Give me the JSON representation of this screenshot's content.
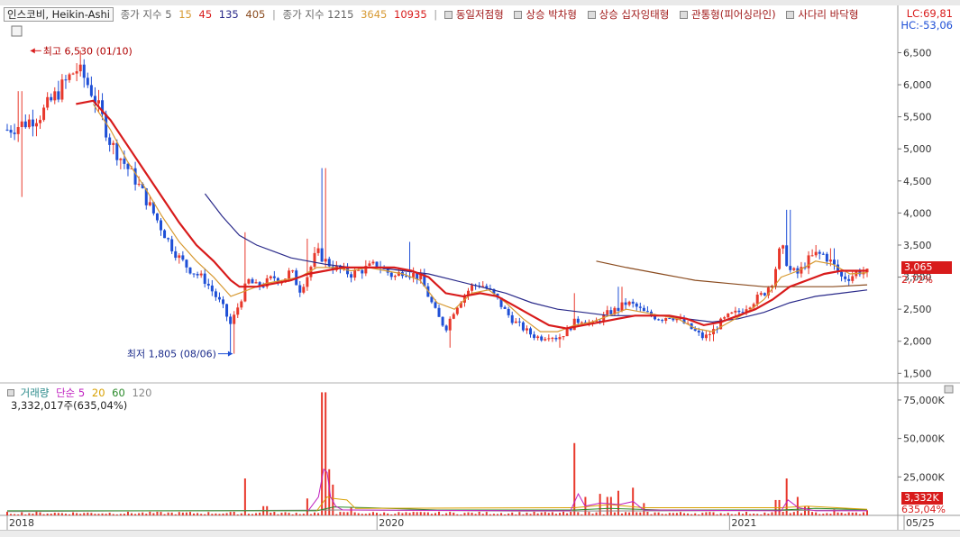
{
  "header": {
    "title": "인스코비, Heikin-Ashi",
    "ma_short": {
      "label": "종가 지수 5",
      "values": [
        "15",
        "45",
        "135",
        "405"
      ]
    },
    "ma_long": {
      "label": "종가 지수 1215",
      "values": [
        "3645",
        "10935"
      ]
    },
    "patterns": [
      "동일저점형",
      "상승 박차형",
      "상승 십자잉태형",
      "관통형(피어싱라인)",
      "사다리 바닥형"
    ],
    "lc": "LC:69,81",
    "hc": "HC:-53,06"
  },
  "price_axis": {
    "ticks": [
      "6,500",
      "6,000",
      "5,500",
      "5,000",
      "4,500",
      "4,000",
      "3,500",
      "3,000",
      "2,500",
      "2,000",
      "1,500"
    ],
    "tick_values": [
      6500,
      6000,
      5500,
      5000,
      4500,
      4000,
      3500,
      3000,
      2500,
      2000,
      1500
    ],
    "range": [
      1350,
      6900
    ]
  },
  "volume_axis": {
    "ticks": [
      "75,000K",
      "50,000K",
      "25,000K"
    ],
    "tick_values": [
      75000,
      50000,
      25000
    ],
    "range": [
      0,
      82000
    ]
  },
  "x_axis": {
    "ticks": [
      "2018",
      "2020",
      "2021",
      "05/25"
    ],
    "tick_pos": [
      0.0,
      0.43,
      0.84,
      1.0
    ]
  },
  "annotations": {
    "high": {
      "text": "최고 6,530 (01/10)",
      "value": 6530,
      "x": 0.027
    },
    "low": {
      "text": "최저 1,805 (08/06)",
      "value": 1805,
      "x": 0.262
    }
  },
  "current": {
    "price": "3,065",
    "price_value": 3065,
    "change": "2,72%",
    "volume": "3,332K",
    "volume_value": 3332,
    "volume_change": "635,04%"
  },
  "volume_legend": {
    "title": "거래량",
    "ma_label": "단순",
    "periods": [
      "5",
      "20",
      "60",
      "120"
    ]
  },
  "volume_info": "3,332,017주(635,04%)",
  "colors": {
    "up": "#e8382b",
    "down": "#1e4fd6",
    "ma_red": "#d81b1b",
    "ma_orange": "#d79a33",
    "ma_navy": "#2a2a8a",
    "ma_brown": "#8a4b1e",
    "tag": "#d81b1b",
    "vol_ma5": "#c020c0",
    "vol_ma20": "#d8a000",
    "vol_ma60": "#2a8a2a",
    "vol_ma120": "#888888"
  },
  "chart_data": {
    "type": "candlestick",
    "title": "인스코비, Heikin-Ashi",
    "x": {
      "start": 0.0,
      "end": 1.0,
      "labels": [
        "2018",
        "2020",
        "2021",
        "05/25"
      ]
    },
    "ylim": [
      1350,
      6900
    ],
    "price_path": [
      [
        0.0,
        5300
      ],
      [
        0.02,
        5400
      ],
      [
        0.04,
        5550
      ],
      [
        0.06,
        5900
      ],
      [
        0.08,
        6250
      ],
      [
        0.09,
        6100
      ],
      [
        0.1,
        5850
      ],
      [
        0.11,
        5500
      ],
      [
        0.12,
        5100
      ],
      [
        0.13,
        4900
      ],
      [
        0.14,
        4700
      ],
      [
        0.15,
        4500
      ],
      [
        0.16,
        4250
      ],
      [
        0.17,
        4000
      ],
      [
        0.18,
        3750
      ],
      [
        0.19,
        3500
      ],
      [
        0.2,
        3300
      ],
      [
        0.21,
        3150
      ],
      [
        0.22,
        3050
      ],
      [
        0.23,
        2950
      ],
      [
        0.24,
        2750
      ],
      [
        0.25,
        2550
      ],
      [
        0.26,
        2250
      ],
      [
        0.27,
        2600
      ],
      [
        0.28,
        2950
      ],
      [
        0.29,
        2850
      ],
      [
        0.3,
        2900
      ],
      [
        0.31,
        3000
      ],
      [
        0.32,
        2950
      ],
      [
        0.33,
        3100
      ],
      [
        0.34,
        2800
      ],
      [
        0.35,
        3050
      ],
      [
        0.36,
        3400
      ],
      [
        0.37,
        3250
      ],
      [
        0.38,
        3150
      ],
      [
        0.39,
        3100
      ],
      [
        0.4,
        3050
      ],
      [
        0.41,
        3100
      ],
      [
        0.42,
        3150
      ],
      [
        0.43,
        3200
      ],
      [
        0.44,
        3100
      ],
      [
        0.45,
        3000
      ],
      [
        0.46,
        3100
      ],
      [
        0.47,
        3050
      ],
      [
        0.48,
        3000
      ],
      [
        0.49,
        2700
      ],
      [
        0.5,
        2400
      ],
      [
        0.51,
        2200
      ],
      [
        0.52,
        2500
      ],
      [
        0.53,
        2700
      ],
      [
        0.54,
        2850
      ],
      [
        0.55,
        2900
      ],
      [
        0.56,
        2800
      ],
      [
        0.57,
        2650
      ],
      [
        0.58,
        2450
      ],
      [
        0.59,
        2300
      ],
      [
        0.6,
        2200
      ],
      [
        0.61,
        2100
      ],
      [
        0.62,
        2050
      ],
      [
        0.63,
        2100
      ],
      [
        0.64,
        2050
      ],
      [
        0.65,
        2150
      ],
      [
        0.66,
        2300
      ],
      [
        0.67,
        2350
      ],
      [
        0.68,
        2250
      ],
      [
        0.69,
        2350
      ],
      [
        0.7,
        2450
      ],
      [
        0.71,
        2500
      ],
      [
        0.72,
        2600
      ],
      [
        0.73,
        2550
      ],
      [
        0.74,
        2450
      ],
      [
        0.75,
        2400
      ],
      [
        0.76,
        2350
      ],
      [
        0.77,
        2400
      ],
      [
        0.78,
        2350
      ],
      [
        0.79,
        2250
      ],
      [
        0.8,
        2150
      ],
      [
        0.81,
        2050
      ],
      [
        0.82,
        2150
      ],
      [
        0.83,
        2300
      ],
      [
        0.84,
        2400
      ],
      [
        0.85,
        2450
      ],
      [
        0.86,
        2550
      ],
      [
        0.87,
        2650
      ],
      [
        0.88,
        2750
      ],
      [
        0.89,
        2950
      ],
      [
        0.9,
        3500
      ],
      [
        0.91,
        3100
      ],
      [
        0.92,
        3050
      ],
      [
        0.93,
        3250
      ],
      [
        0.94,
        3350
      ],
      [
        0.95,
        3350
      ],
      [
        0.96,
        3200
      ],
      [
        0.97,
        3000
      ],
      [
        0.98,
        3000
      ],
      [
        0.99,
        3100
      ],
      [
        1.0,
        3065
      ]
    ],
    "spikes": [
      [
        0.007,
        4100
      ],
      [
        0.015,
        5900
      ],
      [
        0.072,
        5600
      ],
      [
        0.086,
        6530
      ],
      [
        0.276,
        3700
      ],
      [
        0.348,
        3600
      ],
      [
        0.368,
        4700
      ],
      [
        0.468,
        3550
      ],
      [
        0.659,
        2750
      ],
      [
        0.712,
        2850
      ],
      [
        0.908,
        4050
      ],
      [
        0.94,
        3500
      ],
      [
        0.96,
        3450
      ]
    ],
    "dips": [
      [
        0.016,
        4250
      ],
      [
        0.262,
        1805
      ],
      [
        0.515,
        1900
      ],
      [
        0.642,
        1900
      ],
      [
        0.82,
        2000
      ]
    ],
    "ma_red": [
      [
        0.08,
        5700
      ],
      [
        0.1,
        5750
      ],
      [
        0.12,
        5450
      ],
      [
        0.14,
        5050
      ],
      [
        0.16,
        4650
      ],
      [
        0.18,
        4250
      ],
      [
        0.2,
        3850
      ],
      [
        0.22,
        3500
      ],
      [
        0.24,
        3250
      ],
      [
        0.26,
        2950
      ],
      [
        0.27,
        2850
      ],
      [
        0.29,
        2850
      ],
      [
        0.31,
        2900
      ],
      [
        0.33,
        2950
      ],
      [
        0.35,
        3050
      ],
      [
        0.37,
        3100
      ],
      [
        0.39,
        3150
      ],
      [
        0.41,
        3150
      ],
      [
        0.43,
        3150
      ],
      [
        0.45,
        3150
      ],
      [
        0.47,
        3100
      ],
      [
        0.49,
        3000
      ],
      [
        0.51,
        2750
      ],
      [
        0.53,
        2700
      ],
      [
        0.55,
        2750
      ],
      [
        0.57,
        2700
      ],
      [
        0.59,
        2550
      ],
      [
        0.61,
        2400
      ],
      [
        0.63,
        2250
      ],
      [
        0.65,
        2200
      ],
      [
        0.67,
        2250
      ],
      [
        0.69,
        2300
      ],
      [
        0.71,
        2350
      ],
      [
        0.73,
        2400
      ],
      [
        0.75,
        2400
      ],
      [
        0.77,
        2400
      ],
      [
        0.79,
        2350
      ],
      [
        0.81,
        2250
      ],
      [
        0.83,
        2300
      ],
      [
        0.85,
        2400
      ],
      [
        0.87,
        2500
      ],
      [
        0.89,
        2650
      ],
      [
        0.91,
        2850
      ],
      [
        0.93,
        2950
      ],
      [
        0.95,
        3050
      ],
      [
        0.97,
        3100
      ],
      [
        1.0,
        3100
      ]
    ],
    "ma_orange": [
      [
        0.1,
        5700
      ],
      [
        0.12,
        5300
      ],
      [
        0.14,
        4800
      ],
      [
        0.16,
        4400
      ],
      [
        0.18,
        3950
      ],
      [
        0.2,
        3550
      ],
      [
        0.22,
        3250
      ],
      [
        0.24,
        3000
      ],
      [
        0.26,
        2700
      ],
      [
        0.28,
        2800
      ],
      [
        0.3,
        2900
      ],
      [
        0.32,
        2950
      ],
      [
        0.34,
        3000
      ],
      [
        0.36,
        3150
      ],
      [
        0.38,
        3150
      ],
      [
        0.4,
        3100
      ],
      [
        0.42,
        3150
      ],
      [
        0.44,
        3100
      ],
      [
        0.46,
        3050
      ],
      [
        0.48,
        2950
      ],
      [
        0.5,
        2600
      ],
      [
        0.52,
        2500
      ],
      [
        0.54,
        2750
      ],
      [
        0.56,
        2800
      ],
      [
        0.58,
        2600
      ],
      [
        0.6,
        2350
      ],
      [
        0.62,
        2150
      ],
      [
        0.64,
        2150
      ],
      [
        0.66,
        2250
      ],
      [
        0.68,
        2300
      ],
      [
        0.7,
        2400
      ],
      [
        0.72,
        2500
      ],
      [
        0.74,
        2450
      ],
      [
        0.76,
        2400
      ],
      [
        0.78,
        2350
      ],
      [
        0.8,
        2200
      ],
      [
        0.82,
        2150
      ],
      [
        0.84,
        2300
      ],
      [
        0.86,
        2450
      ],
      [
        0.88,
        2650
      ],
      [
        0.9,
        3000
      ],
      [
        0.92,
        3100
      ],
      [
        0.94,
        3250
      ],
      [
        0.96,
        3200
      ],
      [
        0.98,
        3050
      ],
      [
        1.0,
        3070
      ]
    ],
    "ma_navy": [
      [
        0.23,
        4300
      ],
      [
        0.25,
        3950
      ],
      [
        0.27,
        3650
      ],
      [
        0.29,
        3500
      ],
      [
        0.31,
        3400
      ],
      [
        0.33,
        3300
      ],
      [
        0.35,
        3250
      ],
      [
        0.37,
        3200
      ],
      [
        0.4,
        3150
      ],
      [
        0.43,
        3150
      ],
      [
        0.46,
        3100
      ],
      [
        0.49,
        3050
      ],
      [
        0.52,
        2950
      ],
      [
        0.55,
        2850
      ],
      [
        0.58,
        2750
      ],
      [
        0.61,
        2600
      ],
      [
        0.64,
        2500
      ],
      [
        0.67,
        2450
      ],
      [
        0.7,
        2400
      ],
      [
        0.73,
        2400
      ],
      [
        0.76,
        2400
      ],
      [
        0.79,
        2350
      ],
      [
        0.82,
        2300
      ],
      [
        0.85,
        2350
      ],
      [
        0.88,
        2450
      ],
      [
        0.91,
        2600
      ],
      [
        0.94,
        2700
      ],
      [
        0.97,
        2750
      ],
      [
        1.0,
        2800
      ]
    ],
    "ma_brown": [
      [
        0.685,
        3250
      ],
      [
        0.72,
        3150
      ],
      [
        0.76,
        3050
      ],
      [
        0.8,
        2950
      ],
      [
        0.84,
        2900
      ],
      [
        0.88,
        2850
      ],
      [
        0.92,
        2850
      ],
      [
        0.96,
        2850
      ],
      [
        1.0,
        2880
      ]
    ],
    "volume": {
      "ylim": [
        0,
        82000
      ],
      "baseline": 1500,
      "spikes": [
        [
          0.276,
          24000
        ],
        [
          0.3,
          6000
        ],
        [
          0.348,
          11000
        ],
        [
          0.368,
          80000
        ],
        [
          0.372,
          30000
        ],
        [
          0.378,
          20000
        ],
        [
          0.4,
          5000
        ],
        [
          0.66,
          47000
        ],
        [
          0.672,
          12000
        ],
        [
          0.69,
          14000
        ],
        [
          0.7,
          12000
        ],
        [
          0.712,
          16000
        ],
        [
          0.728,
          18000
        ],
        [
          0.74,
          8000
        ],
        [
          0.896,
          10000
        ],
        [
          0.908,
          24000
        ],
        [
          0.92,
          12000
        ],
        [
          0.93,
          6000
        ],
        [
          0.96,
          4000
        ],
        [
          1.0,
          3332
        ]
      ],
      "ma5": [
        [
          0.35,
          3000
        ],
        [
          0.362,
          12000
        ],
        [
          0.368,
          30000
        ],
        [
          0.372,
          28000
        ],
        [
          0.376,
          12000
        ],
        [
          0.382,
          6000
        ],
        [
          0.39,
          3500
        ],
        [
          0.655,
          3000
        ],
        [
          0.664,
          14000
        ],
        [
          0.672,
          6000
        ],
        [
          0.69,
          8000
        ],
        [
          0.712,
          7000
        ],
        [
          0.728,
          9000
        ],
        [
          0.74,
          3500
        ],
        [
          0.9,
          3000
        ],
        [
          0.908,
          10000
        ],
        [
          0.92,
          5000
        ],
        [
          0.94,
          3000
        ],
        [
          1.0,
          3000
        ]
      ],
      "ma20": [
        [
          0.36,
          3000
        ],
        [
          0.372,
          12000
        ],
        [
          0.38,
          11000
        ],
        [
          0.395,
          10000
        ],
        [
          0.405,
          4500
        ],
        [
          0.66,
          5000
        ],
        [
          0.7,
          7000
        ],
        [
          0.74,
          5000
        ],
        [
          0.9,
          5000
        ],
        [
          0.93,
          6000
        ],
        [
          1.0,
          4000
        ]
      ],
      "ma60": [
        [
          0.0,
          3000
        ],
        [
          0.36,
          3000
        ],
        [
          0.38,
          5500
        ],
        [
          0.42,
          5000
        ],
        [
          0.5,
          3500
        ],
        [
          0.66,
          3500
        ],
        [
          0.7,
          4500
        ],
        [
          0.76,
          3500
        ],
        [
          0.9,
          3500
        ],
        [
          0.94,
          4500
        ],
        [
          1.0,
          3800
        ]
      ],
      "ma120": [
        [
          0.0,
          2500
        ],
        [
          0.4,
          3500
        ],
        [
          0.6,
          2800
        ],
        [
          0.8,
          3000
        ],
        [
          1.0,
          3500
        ]
      ]
    }
  }
}
